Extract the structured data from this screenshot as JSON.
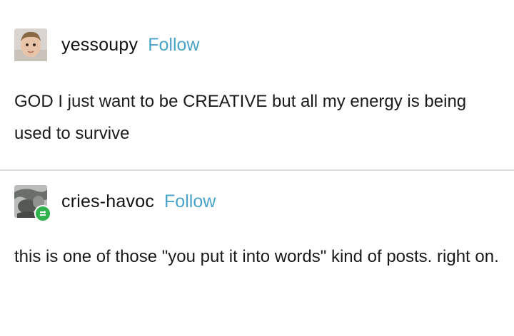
{
  "posts": [
    {
      "username": "yessoupy",
      "follow_label": "Follow",
      "text": "GOD I just want to be CREATIVE but all my energy is being used to survive",
      "avatar_icon": "child-portrait-avatar"
    },
    {
      "username": "cries-havoc",
      "follow_label": "Follow",
      "text": "this is one of those \"you put it into words\" kind of posts. right on.",
      "avatar_icon": "abstract-photo-avatar",
      "badge_icon": "reblog-icon"
    }
  ],
  "colors": {
    "follow": "#4aa3c8",
    "reblog_badge": "#2fb34a",
    "divider": "#dcdcdc"
  }
}
